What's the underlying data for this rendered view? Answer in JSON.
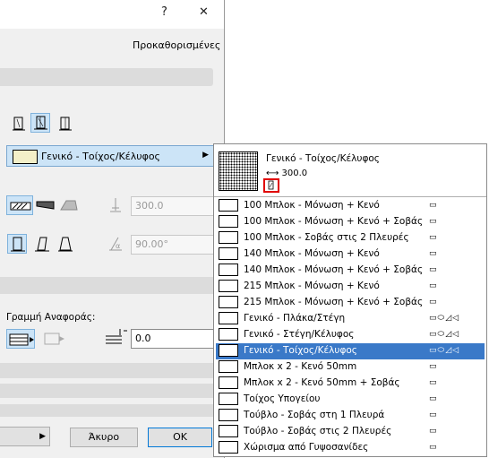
{
  "dialog": {
    "title_help": "?",
    "title_close": "✕",
    "presets_label": "Προκαθορισμένες",
    "selected_material": "Γενικό - Τοίχος/Κέλυφος",
    "height_value": "300.0",
    "angle_value": "90.00°",
    "reference_line_label": "Γραμμή Αναφοράς:",
    "offset_value": "0.0",
    "cancel_label": "Άκυρο",
    "ok_label": "OK"
  },
  "popup": {
    "preview_name": "Γενικό - Τοίχος/Κέλυφος",
    "preview_thickness": "300.0",
    "items": [
      {
        "name": "100 Μπλοκ - Μόνωση + Κενό",
        "pattern": "cross",
        "icons": "▭"
      },
      {
        "name": "100 Μπλοκ - Μόνωση + Κενό + Σοβάς",
        "pattern": "cross",
        "icons": "▭"
      },
      {
        "name": "100 Μπλοκ - Σοβάς στις 2 Πλευρές",
        "pattern": "cross",
        "icons": "▭"
      },
      {
        "name": "140 Μπλοκ - Μόνωση + Κενό",
        "pattern": "cross",
        "icons": "▭"
      },
      {
        "name": "140 Μπλοκ - Μόνωση + Κενό + Σοβάς",
        "pattern": "cross",
        "icons": "▭"
      },
      {
        "name": "215 Μπλοκ - Μόνωση + Κενό",
        "pattern": "cross",
        "icons": "▭"
      },
      {
        "name": "215 Μπλοκ - Μόνωση + Κενό + Σοβάς",
        "pattern": "cross",
        "icons": "▭"
      },
      {
        "name": "Γενικό - Πλάκα/Στέγη",
        "pattern": "vert",
        "icons": "▭⬭◿◁"
      },
      {
        "name": "Γενικό - Στέγη/Κέλυφος",
        "pattern": "dot",
        "icons": "▭⬭◿◁"
      },
      {
        "name": "Γενικό - Τοίχος/Κέλυφος",
        "pattern": "dot",
        "icons": "▭⬭◿◁",
        "selected": true
      },
      {
        "name": "Μπλοκ x 2 - Κενό 50mm",
        "pattern": "cross",
        "icons": "▭"
      },
      {
        "name": "Μπλοκ x 2 - Κενό 50mm + Σοβάς",
        "pattern": "cross",
        "icons": "▭"
      },
      {
        "name": "Τοίχος Υπογείου",
        "pattern": "dot",
        "icons": "▭"
      },
      {
        "name": "Τούβλο - Σοβάς στη 1 Πλευρά",
        "pattern": "diag",
        "icons": "▭"
      },
      {
        "name": "Τούβλο - Σοβάς στις 2 Πλευρές",
        "pattern": "diag",
        "icons": "▭"
      },
      {
        "name": "Χώρισμα από Γυψοσανίδες",
        "pattern": "plain",
        "icons": "▭"
      }
    ]
  }
}
